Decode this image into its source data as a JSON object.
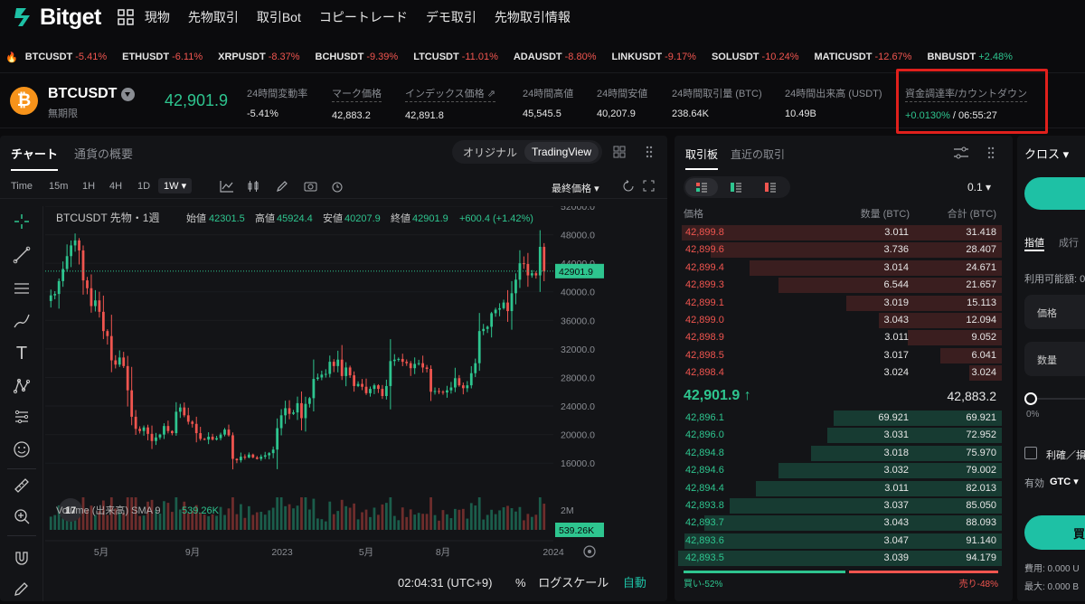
{
  "brand": {
    "name": "Bitget"
  },
  "nav": {
    "items": [
      "現物",
      "先物取引",
      "取引Bot",
      "コピートレード",
      "デモ取引",
      "先物取引情報"
    ]
  },
  "ticker": [
    {
      "sym": "BTCUSDT",
      "chg": "-5.41%",
      "dir": "neg"
    },
    {
      "sym": "ETHUSDT",
      "chg": "-6.11%",
      "dir": "neg"
    },
    {
      "sym": "XRPUSDT",
      "chg": "-8.37%",
      "dir": "neg"
    },
    {
      "sym": "BCHUSDT",
      "chg": "-9.39%",
      "dir": "neg"
    },
    {
      "sym": "LTCUSDT",
      "chg": "-11.01%",
      "dir": "neg"
    },
    {
      "sym": "ADAUSDT",
      "chg": "-8.80%",
      "dir": "neg"
    },
    {
      "sym": "LINKUSDT",
      "chg": "-9.17%",
      "dir": "neg"
    },
    {
      "sym": "SOLUSDT",
      "chg": "-10.24%",
      "dir": "neg"
    },
    {
      "sym": "MATICUSDT",
      "chg": "-12.67%",
      "dir": "neg"
    },
    {
      "sym": "BNBUSDT",
      "chg": "+2.48%",
      "dir": "pos"
    }
  ],
  "symbol": {
    "coin_glyph": "₿",
    "name": "BTCUSDT",
    "sub": "無期限",
    "last_price": "42,901.9"
  },
  "stats": [
    {
      "label": "24時間変動率",
      "value": "-5.41%",
      "dir": "neg"
    },
    {
      "label": "マーク価格",
      "value": "42,883.2",
      "dir": "pos"
    },
    {
      "label": "インデックス価格",
      "value": "42,891.8",
      "dir": ""
    },
    {
      "label": "24時間高値",
      "value": "45,545.5",
      "dir": ""
    },
    {
      "label": "24時間安値",
      "value": "40,207.9",
      "dir": ""
    },
    {
      "label": "24時間取引量 (BTC)",
      "value": "238.64K",
      "dir": ""
    },
    {
      "label": "24時間出来高 (USDT)",
      "value": "10.49B",
      "dir": ""
    },
    {
      "label": "資金調達率/カウントダウン",
      "value_rate": "+0.0130%",
      "value_cd": "/ 06:55:27"
    }
  ],
  "chart_panel": {
    "tab_chart": "チャート",
    "tab_overview": "通貨の概要",
    "view_original": "オリジナル",
    "view_tv": "TradingView",
    "timeframes": [
      "Time",
      "15m",
      "1H",
      "4H",
      "1D",
      "1W"
    ],
    "active_tf": "1W",
    "price_type": "最終価格",
    "legend_title": "BTCUSDT 先物・1週",
    "ohlc": {
      "o_label": "始値",
      "o": "42301.5",
      "h_label": "高値",
      "h": "45924.4",
      "l_label": "安値",
      "l": "40207.9",
      "c_label": "終値",
      "c": "42901.9",
      "chg": "+600.4 (+1.42%)"
    },
    "volume_label": "Volume (出来高) SMA 9",
    "volume_value": "539.26K",
    "volume_axis": "2M",
    "time": "02:04:31 (UTC+9)",
    "percent": "%",
    "log": "ログスケール",
    "auto": "自動",
    "tv_badge": "17"
  },
  "chart_data": {
    "type": "candlestick",
    "title": "BTCUSDT 先物・1週",
    "y_ticks": [
      "52000.0",
      "48000.0",
      "44000.0",
      "40000.0",
      "36000.0",
      "32000.0",
      "28000.0",
      "24000.0",
      "20000.0",
      "16000.0"
    ],
    "y_range": [
      14000,
      52000
    ],
    "x_ticks": [
      "5月",
      "9月",
      "2023",
      "5月",
      "8月",
      "2024"
    ],
    "last_price_label": "42901.9",
    "last_price": 42901.9,
    "volume_label_value": "539.26K",
    "closes": [
      39500,
      39700,
      41500,
      43200,
      45000,
      46500,
      47200,
      45800,
      41600,
      40500,
      38000,
      38800,
      37200,
      34500,
      33800,
      30400,
      29800,
      30800,
      29600,
      26200,
      22500,
      20800,
      20500,
      21000,
      20100,
      19100,
      19600,
      20000,
      21200,
      20500,
      20200,
      23200,
      23800,
      22700,
      21800,
      21500,
      20200,
      19400,
      19300,
      19700,
      19300,
      19500,
      20000,
      20700,
      19900,
      16600,
      16400,
      16900,
      16800,
      17200,
      16800,
      16600,
      16900,
      17100,
      17400,
      17900,
      20900,
      22700,
      23700,
      22900,
      23100,
      24400,
      22300,
      24300,
      25100,
      27800,
      28000,
      28400,
      28500,
      30200,
      29600,
      30500,
      28200,
      29400,
      28300,
      26800,
      27100,
      26700,
      25800,
      26400,
      26900,
      26400,
      25400,
      26800,
      30300,
      30500,
      30600,
      30200,
      30000,
      29300,
      29900,
      30000,
      29400,
      29200,
      26000,
      26100,
      26000,
      25900,
      26200,
      26600,
      27900,
      26900,
      26500,
      26900,
      28600,
      30000,
      34500,
      34800,
      35100,
      37000,
      37500,
      37700,
      38500,
      37300,
      39800,
      41700,
      44000,
      43900,
      42300,
      42600,
      42300,
      46300,
      42900
    ],
    "ohlc_source": "closes"
  },
  "orderbook": {
    "tab_book": "取引板",
    "tab_recent": "直近の取引",
    "step": "0.1",
    "col_price": "価格",
    "col_qty": "数量 (BTC)",
    "col_total": "合計 (BTC)",
    "asks": [
      {
        "price": "42,899.8",
        "qty": "3.011",
        "total": "31.418",
        "depth": 0.99
      },
      {
        "price": "42,899.6",
        "qty": "3.736",
        "total": "28.407",
        "depth": 0.9
      },
      {
        "price": "42,899.4",
        "qty": "3.014",
        "total": "24.671",
        "depth": 0.78
      },
      {
        "price": "42,899.3",
        "qty": "6.544",
        "total": "21.657",
        "depth": 0.69
      },
      {
        "price": "42,899.1",
        "qty": "3.019",
        "total": "15.113",
        "depth": 0.48
      },
      {
        "price": "42,899.0",
        "qty": "3.043",
        "total": "12.094",
        "depth": 0.38
      },
      {
        "price": "42,898.9",
        "qty": "3.011",
        "total": "9.052",
        "depth": 0.29
      },
      {
        "price": "42,898.5",
        "qty": "3.017",
        "total": "6.041",
        "depth": 0.19
      },
      {
        "price": "42,898.4",
        "qty": "3.024",
        "total": "3.024",
        "depth": 0.1
      }
    ],
    "mid_price": "42,901.9",
    "mid_arrow": "↑",
    "mid_mark": "42,883.2",
    "bids": [
      {
        "price": "42,896.1",
        "qty": "69.921",
        "total": "69.921",
        "depth": 0.52
      },
      {
        "price": "42,896.0",
        "qty": "3.031",
        "total": "72.952",
        "depth": 0.54
      },
      {
        "price": "42,894.8",
        "qty": "3.018",
        "total": "75.970",
        "depth": 0.59
      },
      {
        "price": "42,894.6",
        "qty": "3.032",
        "total": "79.002",
        "depth": 0.69
      },
      {
        "price": "42,894.4",
        "qty": "3.011",
        "total": "82.013",
        "depth": 0.76
      },
      {
        "price": "42,893.8",
        "qty": "3.037",
        "total": "85.050",
        "depth": 0.84
      },
      {
        "price": "42,893.7",
        "qty": "3.043",
        "total": "88.093",
        "depth": 0.92
      },
      {
        "price": "42,893.6",
        "qty": "3.047",
        "total": "91.140",
        "depth": 0.98
      },
      {
        "price": "42,893.5",
        "qty": "3.039",
        "total": "94.179",
        "depth": 1.0
      }
    ],
    "buy_ratio": "買い-52%",
    "sell_ratio": "売り-48%",
    "buy_pct": 52
  },
  "order_panel": {
    "mode": "クロス",
    "tab_limit": "指値",
    "tab_exec": "成行",
    "available": "利用可能額: 0",
    "price_label": "価格",
    "qty_label": "数量",
    "slider_value": "0%",
    "tpsl": "利確／損",
    "validity_label": "有効",
    "validity_value": "GTC",
    "buy_label": "買",
    "fee": "費用: 0.000 U",
    "max": "最大: 0.000 B"
  },
  "colors": {
    "up": "#2ec58f",
    "down": "#f0554f",
    "accent": "#1ec1a5",
    "highlight": "#e0201c"
  }
}
